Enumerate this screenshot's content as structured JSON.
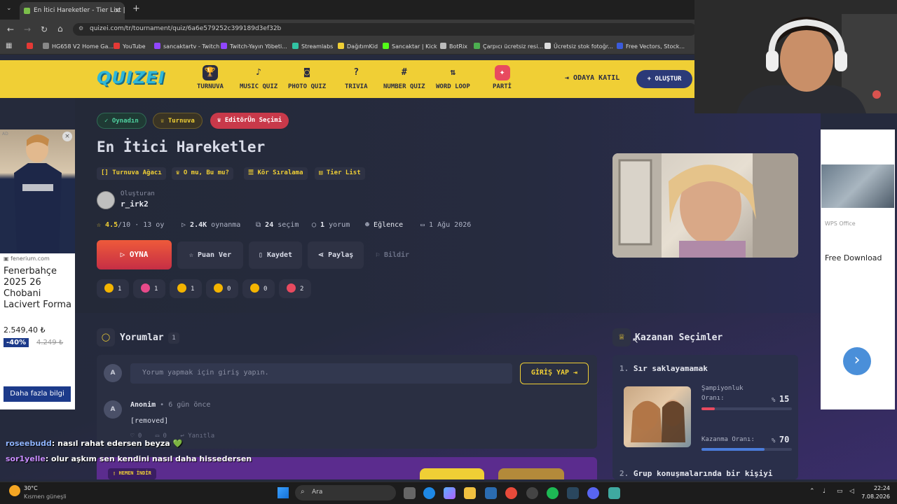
{
  "browser": {
    "tab_title": "En İtici Hareketler - Tier List | Ki",
    "url": "quizei.com/tr/tournament/quiz/6a6e579252c399189d3ef32b",
    "bookmarks": [
      "HG658 V2 Home Ga...",
      "YouTube",
      "sancaktartv - Twitch",
      "Twitch-Yayın Yöbeti...",
      "Streamlabs",
      "DağıtımKid",
      "Sancaktar | Kick",
      "BotRix",
      "Çarpıcı ücretsiz resi...",
      "Ücretsiz stok fotoğr...",
      "Free Vectors, Stock..."
    ]
  },
  "header": {
    "logo": "QUIZEI",
    "nav": [
      "TURNUVA",
      "MUSIC QUIZ",
      "PHOTO QUIZ",
      "TRIVIA",
      "NUMBER QUIZ",
      "WORD LOOP",
      "PARTİ"
    ],
    "join_label": "ODAYA KATIL",
    "create_label": "+ OLUŞTUR"
  },
  "quiz": {
    "chips": [
      "Oynadın",
      "Turnuva",
      "EditörÜn Seçimi"
    ],
    "title": "En İtici Hareketler",
    "modes": [
      "Turnuva Ağacı",
      "O mu, Bu mu?",
      "Kör Sıralama",
      "Tier List"
    ],
    "creator_label": "Oluşturan",
    "creator_name": "r_irk2",
    "rating": "4.5",
    "rating_suffix": "/10 · 13 oy",
    "plays_value": "2.4K",
    "plays_label": "oynanma",
    "choices_value": "24",
    "choices_label": "seçim",
    "comments_value": "1",
    "comments_label": "yorum",
    "category": "Eğlence",
    "date": "1 Ağu 2026",
    "play_label": "OYNA",
    "rate_label": "Puan Ver",
    "save_label": "Kaydet",
    "share_label": "Paylaş",
    "report_label": "Bildir",
    "reactions": [
      {
        "icon": "thumbs-up",
        "count": "1",
        "color": "#f4b400"
      },
      {
        "icon": "heart",
        "count": "1",
        "color": "#e84a8a"
      },
      {
        "icon": "laugh",
        "count": "1",
        "color": "#f4b400"
      },
      {
        "icon": "surprised",
        "count": "0",
        "color": "#f4b400"
      },
      {
        "icon": "sad",
        "count": "0",
        "color": "#f4b400"
      },
      {
        "icon": "angry",
        "count": "2",
        "color": "#e84a5f"
      }
    ]
  },
  "comments": {
    "title": "Yorumlar",
    "count": "1",
    "placeholder": "Yorum yapmak için giriş yapın.",
    "login_label": "GİRİŞ YAP",
    "avatar_letter": "A",
    "items": [
      {
        "author": "Anonim",
        "time": "• 6 gün önce",
        "text": "[removed]",
        "likes": "0",
        "replies": "0",
        "reply_label": "Yanıtla"
      }
    ]
  },
  "winners": {
    "title": "Kazanan Seçimler",
    "items": [
      {
        "rank": "1.",
        "name": "Sır saklayamamak",
        "champ_label": "Şampiyonluk Oranı:",
        "champ_pct": "15",
        "champ_fraction": 0.15,
        "win_label": "Kazanma Oranı:",
        "win_pct": "70",
        "win_fraction": 0.7
      },
      {
        "rank": "2.",
        "name": "Grup konuşmalarında bir kişiyi"
      }
    ]
  },
  "ads": {
    "left_domain": "fenerium.com",
    "left_title": "Fenerbahçe 2025 26 Chobani Lacivert Forma",
    "left_price": "2.549,40 ₺",
    "left_discount": "-40%",
    "left_old_price": "4.249 ₺",
    "left_cta": "Daha fazla bilgi",
    "left_badge": "AD",
    "right_brand": "WPS Office",
    "right_cta": "Free Download"
  },
  "chat": [
    {
      "user": "roseebudd",
      "message": ": nasıl rahat edersen beyza 💚",
      "color": "#8fb4ff"
    },
    {
      "user": "sor1yelle",
      "message": ": olur aşkım sen kendini nasıl daha hissedersen",
      "color": "#c98cff"
    }
  ],
  "banner_label": "HEMEN İNDİR",
  "taskbar": {
    "weather_temp": "30°C",
    "weather_desc": "Kısmen güneşli",
    "search": "Ara",
    "time": "22:24",
    "date": "7.08.2026"
  },
  "colors": {
    "accent": "#f0cf35",
    "primary": "#e84a5f",
    "navy": "#2b3a78"
  }
}
